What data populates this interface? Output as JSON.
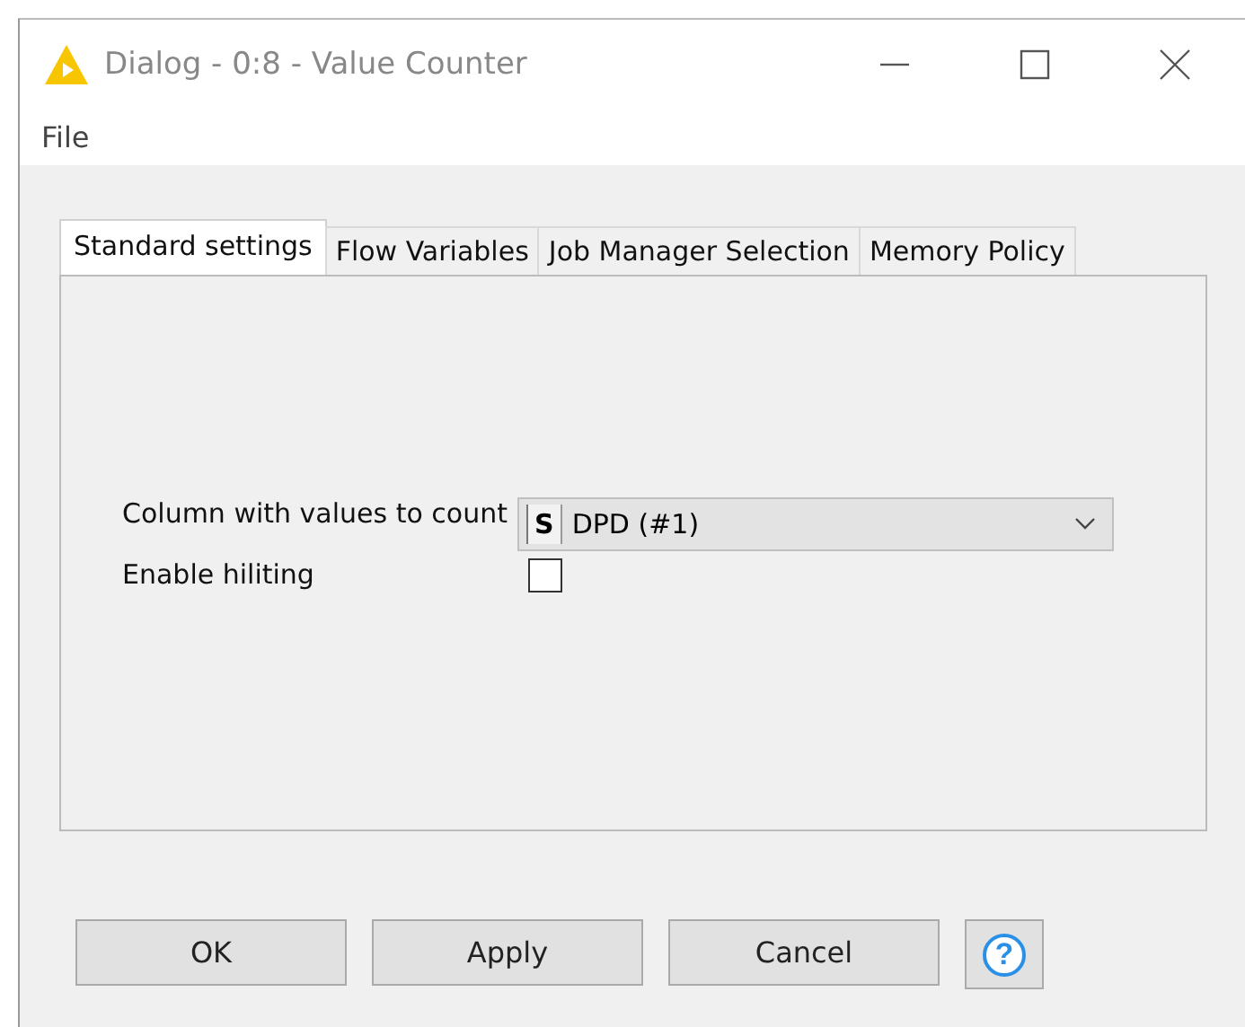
{
  "window": {
    "title": "Dialog - 0:8 - Value Counter"
  },
  "menu": [
    "File"
  ],
  "tabs": [
    {
      "label": "Standard settings",
      "selected": true
    },
    {
      "label": "Flow Variables",
      "selected": false
    },
    {
      "label": "Job Manager Selection",
      "selected": false
    },
    {
      "label": "Memory Policy",
      "selected": false
    }
  ],
  "settings": [
    {
      "kind": "dropdown",
      "label": "Column with values to count",
      "type_badge": "S",
      "value": "DPD (#1)"
    },
    {
      "kind": "checkbox",
      "label": "Enable hiliting",
      "checked": false
    }
  ],
  "buttons": [
    "OK",
    "Apply",
    "Cancel"
  ],
  "help_button": {
    "label": "?"
  }
}
